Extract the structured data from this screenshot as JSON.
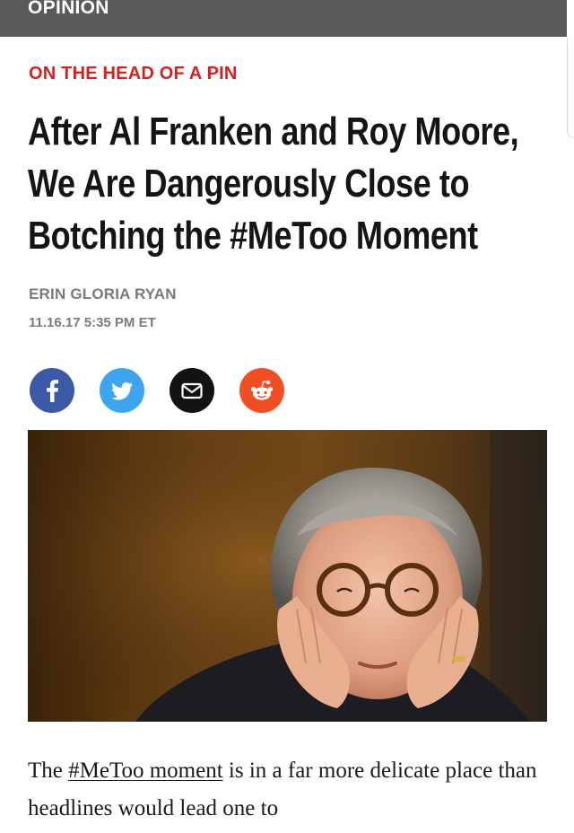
{
  "header": {
    "section": "OPINION"
  },
  "article": {
    "kicker": "ON THE HEAD OF A PIN",
    "headline": [
      "After Al Franken and Roy Moore,",
      "We Are Dangerously Close to",
      "Botching the #MeToo Moment"
    ],
    "author": "ERIN GLORIA RYAN",
    "date": "11.16.17 5:35 PM ET",
    "body": {
      "before": "The ",
      "link": "#MeToo moment",
      "after": " is in a far more delicate place than headlines would lead one to"
    }
  },
  "share": {
    "items": [
      {
        "icon": "facebook-icon",
        "color": "#3b5aa6"
      },
      {
        "icon": "twitter-icon",
        "color": "#3da5ee"
      },
      {
        "icon": "email-icon",
        "color": "#121212"
      },
      {
        "icon": "reddit-icon",
        "color": "#f04e23"
      }
    ]
  },
  "colors": {
    "kicker": "#d32121",
    "topbar": "#5a5a5a"
  }
}
